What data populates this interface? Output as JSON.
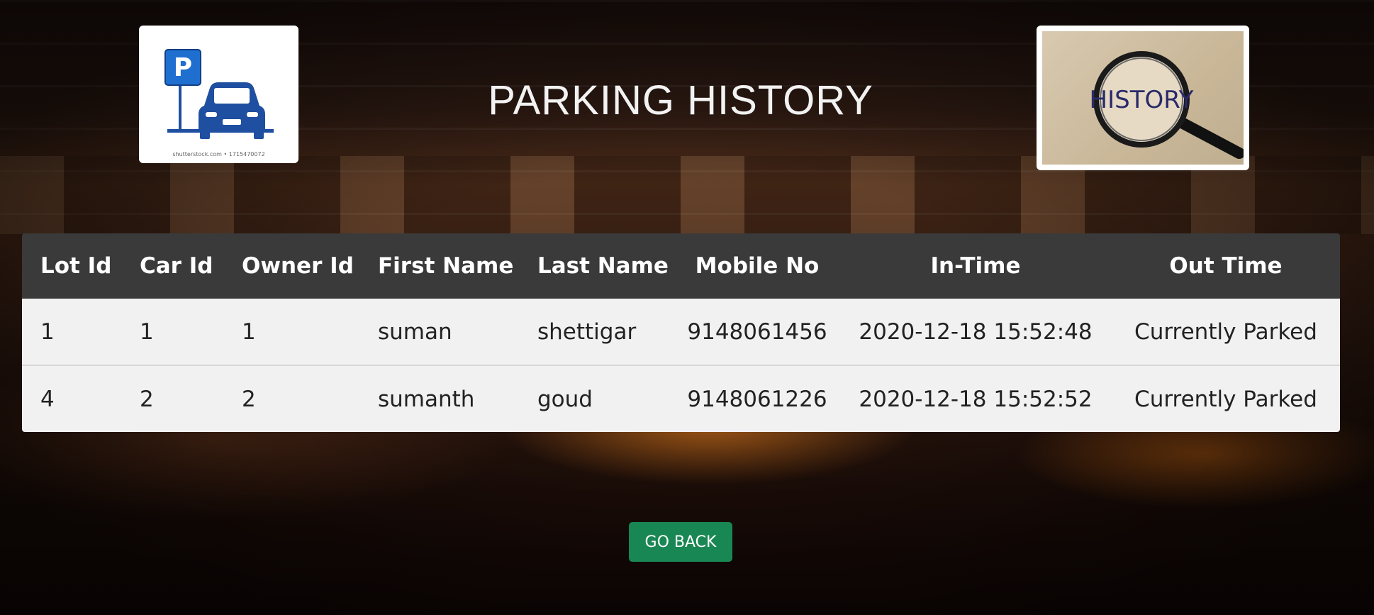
{
  "page": {
    "title": "PARKING HISTORY"
  },
  "logo": {
    "icon": "parking-car-icon",
    "caption": "shutterstock.com • 1715470072",
    "sign_letter": "P"
  },
  "history_image": {
    "icon": "magnifying-glass-icon",
    "text": "HISTORY"
  },
  "table": {
    "headers": [
      "Lot Id",
      "Car Id",
      "Owner Id",
      "First Name",
      "Last Name",
      "Mobile No",
      "In-Time",
      "Out Time"
    ],
    "rows": [
      [
        "1",
        "1",
        "1",
        "suman",
        "shettigar",
        "9148061456",
        "2020-12-18 15:52:48",
        "Currently Parked"
      ],
      [
        "4",
        "2",
        "2",
        "sumanth",
        "goud",
        "9148061226",
        "2020-12-18 15:52:52",
        "Currently Parked"
      ]
    ]
  },
  "actions": {
    "go_back_label": "GO BACK"
  },
  "colors": {
    "header_bg": "#3a3a3a",
    "row_bg": "#f1f1f1",
    "button_bg": "#198754",
    "logo_blue": "#1f4fa0"
  }
}
